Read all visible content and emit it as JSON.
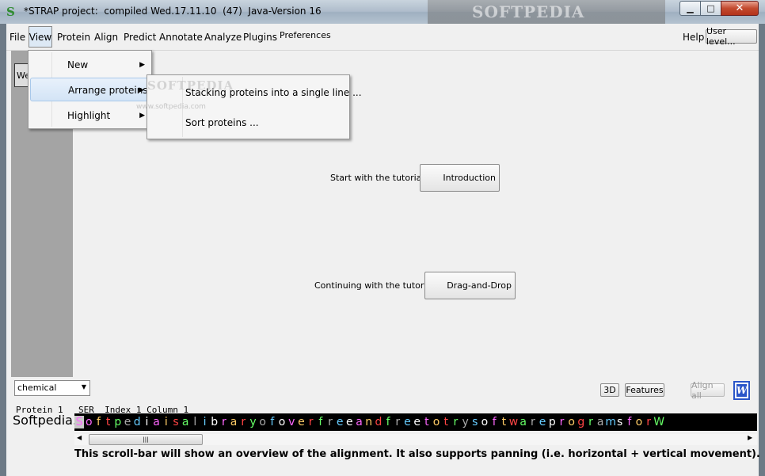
{
  "window": {
    "title": "*STRAP project:  compiled Wed.17.11.10  (47)  Java-Version 16",
    "icon": "S",
    "watermark": "SOFTPEDIA",
    "controls": {
      "minimize": "▁",
      "maximize": "□",
      "close": "✕"
    }
  },
  "menubar": {
    "items": [
      "File",
      "View",
      "Protein",
      "Align",
      "Predict",
      "Annotate",
      "Analyze",
      "Plugins",
      "Preferences"
    ],
    "help": "Help",
    "user_level": "User level..."
  },
  "left_panel": {
    "tab_label": "We"
  },
  "view_menu": {
    "items": [
      {
        "label": "New",
        "arrow": "▶"
      },
      {
        "label": "Arrange proteins",
        "arrow": "▶"
      },
      {
        "label": "Highlight",
        "arrow": "▶"
      }
    ]
  },
  "arrange_submenu": {
    "items": [
      "Stacking proteins into a single line ...",
      "Sort proteins ..."
    ],
    "watermark": "SOFTPEDIA",
    "watermark_url": "www.softpedia.com"
  },
  "tutorial": {
    "start_label": "Start with the tutorial",
    "start_button": "Introduction",
    "continue_label": "Continuing with the tutorial",
    "continue_button": "Drag-and-Drop"
  },
  "bottom": {
    "coloring_select": "chemical",
    "btn_3d": "3D",
    "btn_features": "Features",
    "btn_align_all": "Align all",
    "btn_w": "W",
    "info_left": "Protein 1",
    "info_right": "SER  Index 1 Column 1",
    "protein_name": "Softpedia.t",
    "sequence": "SoftpediaisalibraryofoverfreeandfreetotrysoftwareprogramsforW",
    "scroll_grip": "|||",
    "scroll_left": "◀",
    "scroll_right": "▶",
    "help_text": "This scroll-bar will show an overview of the alignment. It also supports panning (i.e. horizontal + vertical movement)."
  },
  "colors": {
    "sequence_palette": [
      "#ffffff",
      "#ff66ff",
      "#ffcc66",
      "#ff4444",
      "#66ff66",
      "#aaaaaa",
      "#66ccff"
    ]
  }
}
